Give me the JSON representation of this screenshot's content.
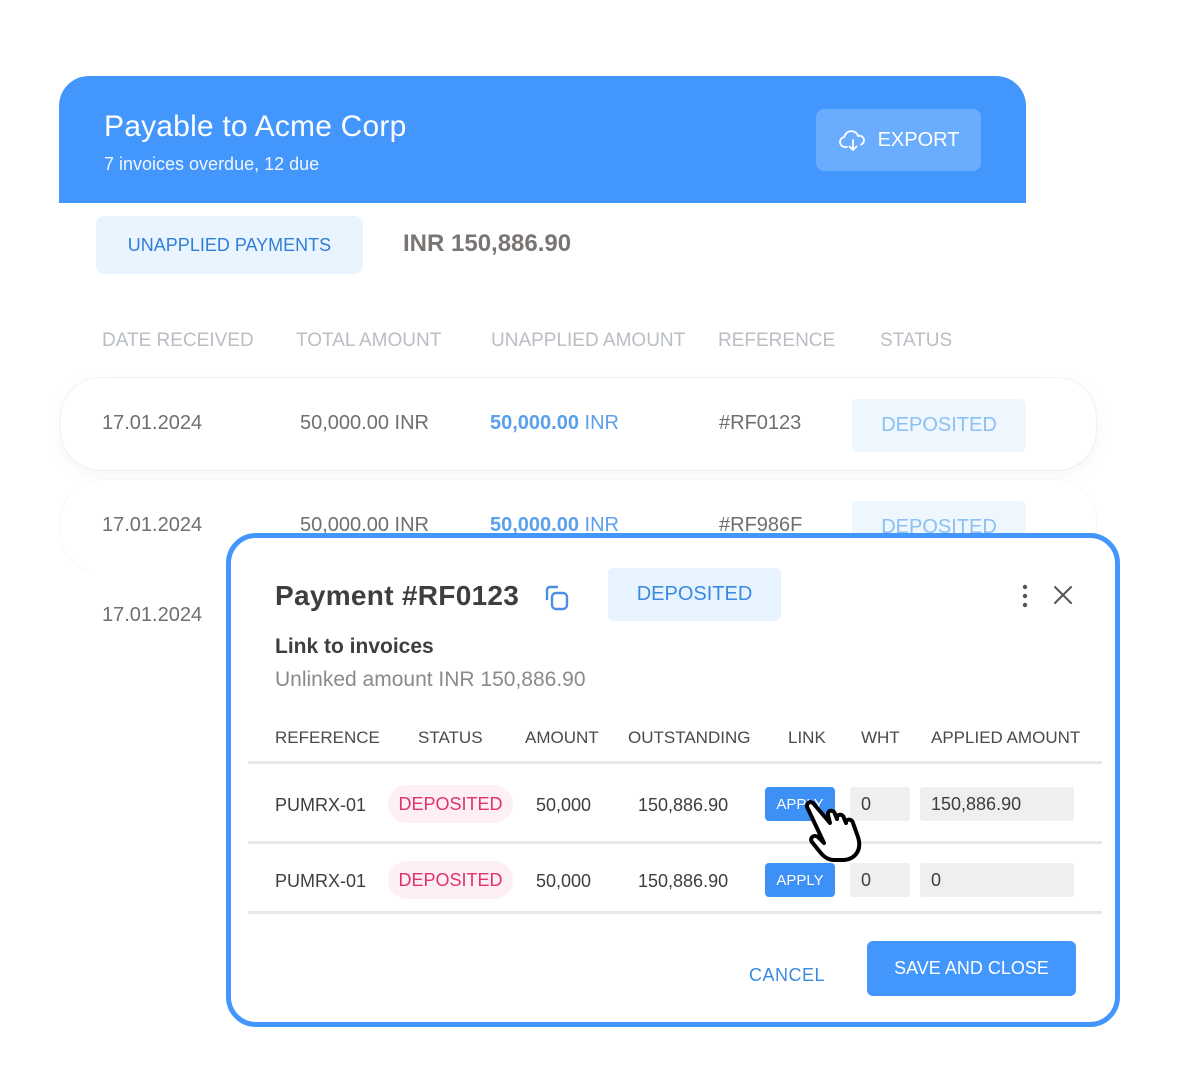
{
  "header": {
    "title": "Payable to Acme Corp",
    "subtitle": "7 invoices overdue, 12 due",
    "export_label": "EXPORT",
    "export_icon": "cloud-download-icon",
    "color": "#4396fc"
  },
  "summary": {
    "tab_label": "UNAPPLIED PAYMENTS",
    "total": "INR 150,886.90"
  },
  "payments_table": {
    "columns": [
      "DATE RECEIVED",
      "TOTAL AMOUNT",
      "UNAPPLIED AMOUNT",
      "REFERENCE",
      "STATUS"
    ],
    "rows": [
      {
        "date": "17.01.2024",
        "total": "50,000.00 INR",
        "unapplied_value": "50,000.00",
        "unapplied_currency": "INR",
        "reference": "#RF0123",
        "status": "DEPOSITED"
      },
      {
        "date": "17.01.2024",
        "total": "50,000.00 INR",
        "unapplied_value": "50,000.00",
        "unapplied_currency": "INR",
        "reference": "#RF986F",
        "status": "DEPOSITED"
      },
      {
        "date": "17.01.2024"
      }
    ]
  },
  "modal": {
    "title": "Payment #RF0123",
    "status": "DEPOSITED",
    "section_title": "Link to invoices",
    "unlinked": "Unlinked amount INR 150,886.90",
    "columns": [
      "REFERENCE",
      "STATUS",
      "AMOUNT",
      "OUTSTANDING",
      "LINK",
      "WHT",
      "APPLIED AMOUNT"
    ],
    "rows": [
      {
        "reference": "PUMRX-01",
        "status": "DEPOSITED",
        "amount": "50,000",
        "outstanding": "150,886.90",
        "link_label": "APPLY",
        "wht": "0",
        "applied": "150,886.90"
      },
      {
        "reference": "PUMRX-01",
        "status": "DEPOSITED",
        "amount": "50,000",
        "outstanding": "150,886.90",
        "link_label": "APPLY",
        "wht": "0",
        "applied": "0"
      }
    ],
    "cancel_label": "CANCEL",
    "save_label": "SAVE AND CLOSE",
    "accent": "#4396fc",
    "status_pink": "#e0336e"
  }
}
